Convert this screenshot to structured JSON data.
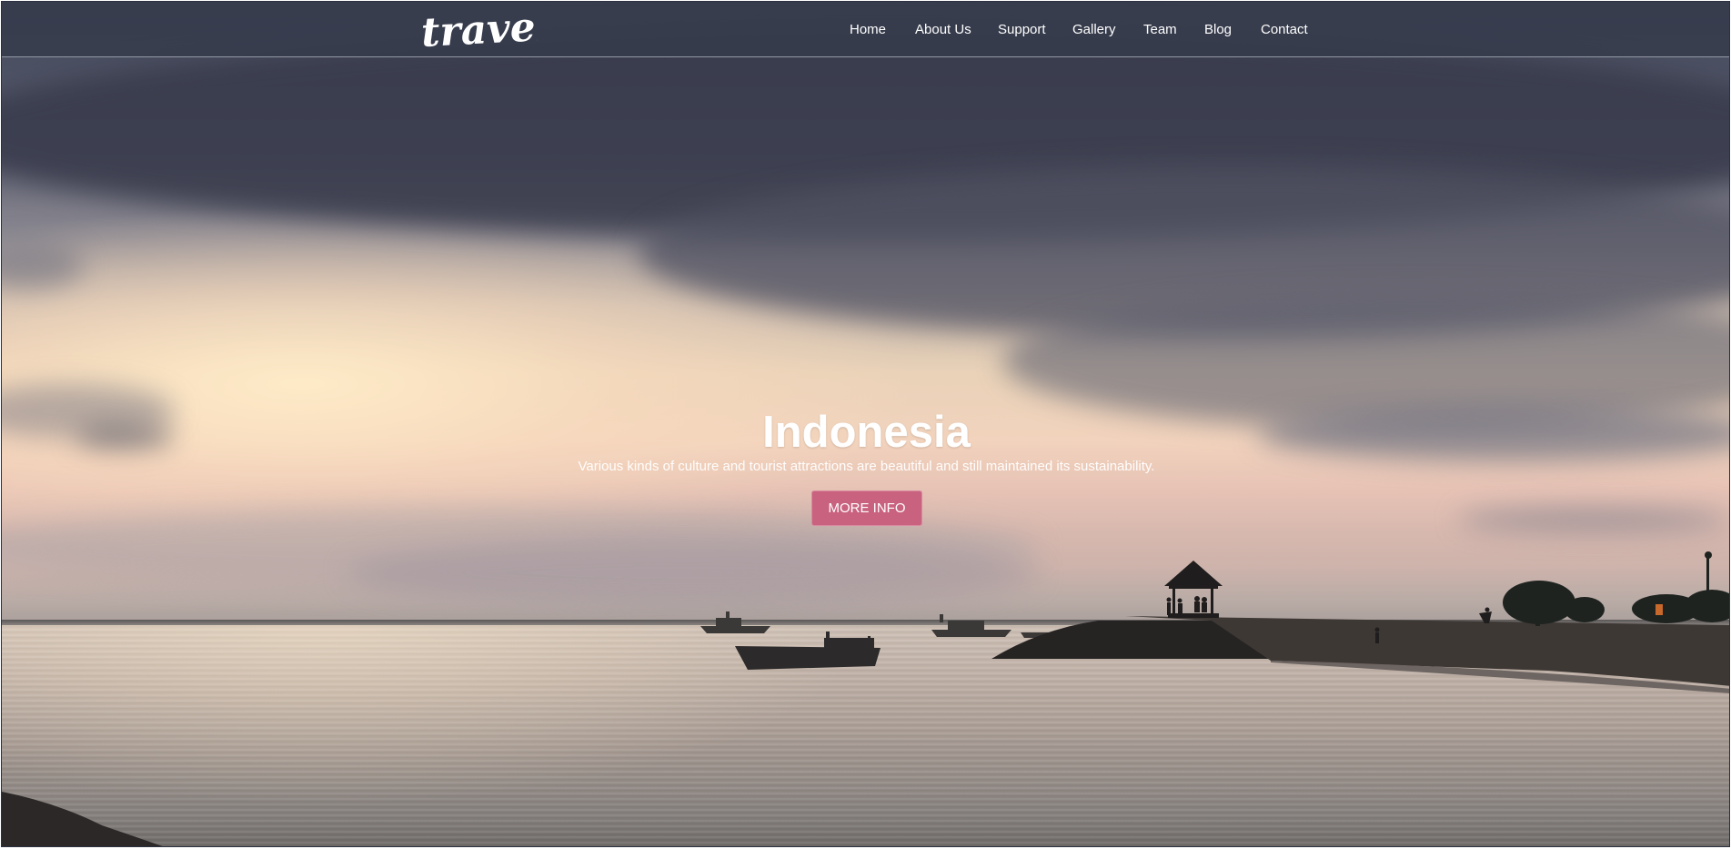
{
  "brand": {
    "logo_text": "travel"
  },
  "nav": {
    "items": [
      {
        "label": "Home"
      },
      {
        "label": "About Us"
      },
      {
        "label": "Support"
      },
      {
        "label": "Gallery"
      },
      {
        "label": "Team"
      },
      {
        "label": "Blog"
      },
      {
        "label": "Contact"
      }
    ]
  },
  "hero": {
    "title": "Indonesia",
    "subtitle": "Various kinds of culture and tourist attractions are beautiful and still maintained its sustainability.",
    "button_label": "MORE INFO"
  },
  "colors": {
    "navbar_bg": "#343a4a",
    "button_bg": "#c9627f",
    "text": "#ffffff"
  }
}
